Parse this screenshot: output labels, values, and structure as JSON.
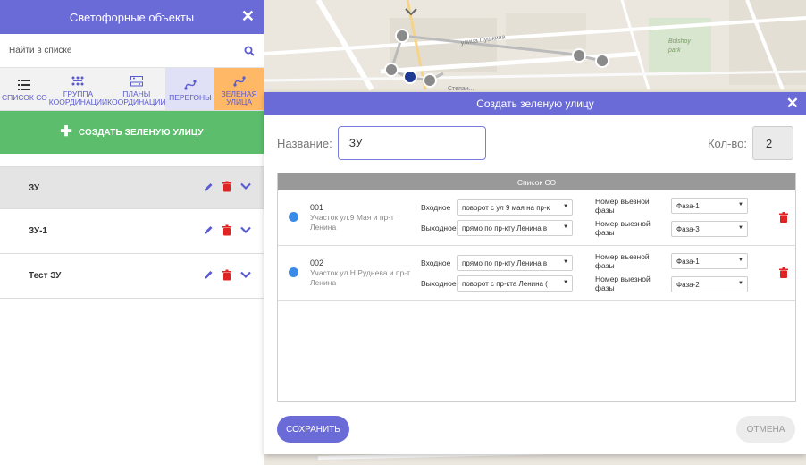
{
  "panel": {
    "title": "Светофорные объекты",
    "search_placeholder": "Найти в списке",
    "tabs": [
      {
        "label": "СПИСОК СО",
        "icon": "list-icon"
      },
      {
        "label": "ГРУППА КООРДИНАЦИИ",
        "icon": "group-coordination-icon"
      },
      {
        "label": "ПЛАНЫ КООРДИНАЦИИ",
        "icon": "plans-icon"
      },
      {
        "label": "ПЕРЕГОНЫ",
        "icon": "route-icon"
      },
      {
        "label": "ЗЕЛЕНАЯ УЛИЦА",
        "icon": "route-icon"
      }
    ],
    "create_label": "СОЗДАТЬ ЗЕЛЕНУЮ УЛИЦУ",
    "items": [
      {
        "label": "ЗУ"
      },
      {
        "label": "ЗУ-1"
      },
      {
        "label": "Тест ЗУ"
      }
    ]
  },
  "map": {
    "labels": [
      "улица Пушкина",
      "Степан...",
      "Bolsho...\npark"
    ]
  },
  "modal": {
    "title": "Создать зеленую улицу",
    "name_label": "Название:",
    "name_value": "ЗУ",
    "count_label": "Кол-во:",
    "count_value": "2",
    "list_header": "Список СО",
    "in_label": "Входное",
    "out_label": "Выходное",
    "in_phase_label": "Номер въезной фазы",
    "out_phase_label": "Номер выезной фазы",
    "rows": [
      {
        "num": "001",
        "addr": "Участок ул.9 Мая и пр-т Ленина",
        "in_dir": "поворот с ул 9 мая на пр-к",
        "out_dir": "прямо по пр-кту Ленина в",
        "in_phase": "Фаза-1",
        "out_phase": "Фаза-3"
      },
      {
        "num": "002",
        "addr": "Участок ул.Н.Руднева и пр-т Ленина",
        "in_dir": "прямо по пр-кту Ленина в",
        "out_dir": "поворот с пр-кта Ленина (",
        "in_phase": "Фаза-1",
        "out_phase": "Фаза-2"
      }
    ],
    "save_label": "СОХРАНИТЬ",
    "cancel_label": "ОТМЕНА"
  },
  "colors": {
    "accent": "#6b6bd8",
    "green": "#5cbd6c",
    "active_tab": "#ffb866",
    "danger": "#e02424",
    "dot": "#3a8be6"
  }
}
